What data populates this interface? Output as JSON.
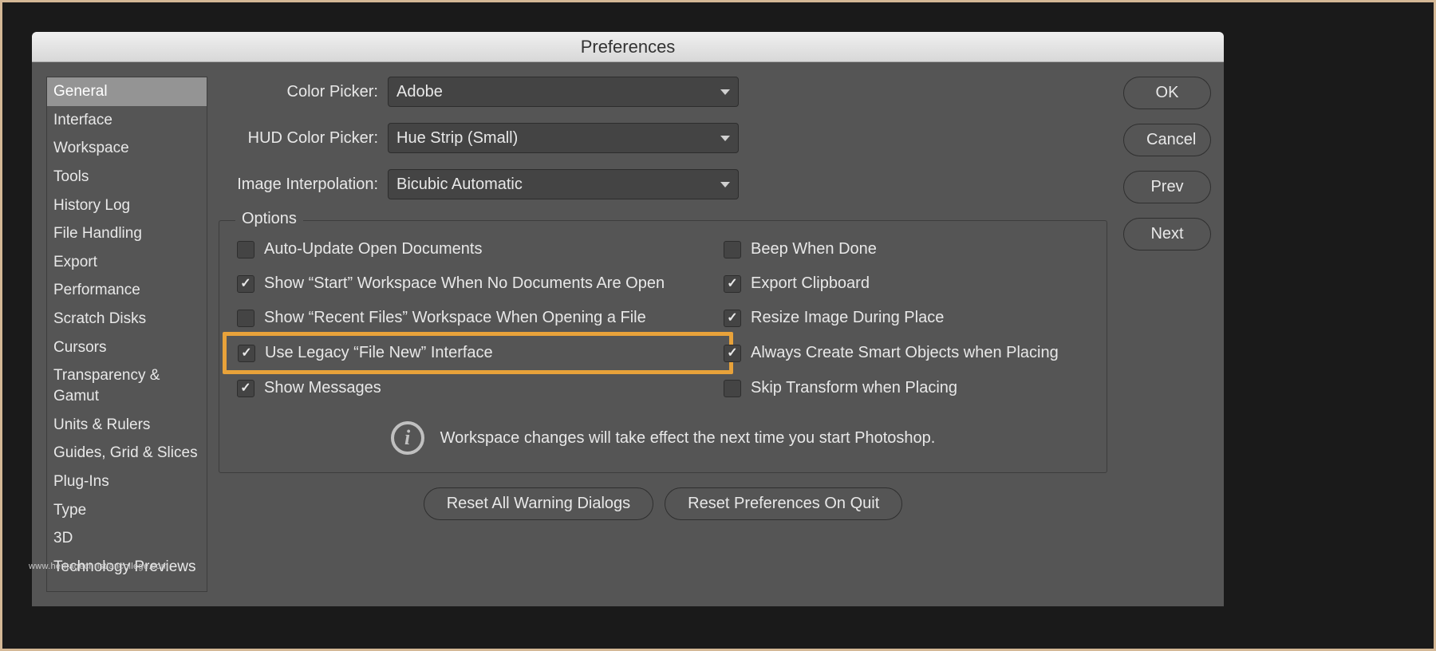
{
  "title": "Preferences",
  "sidebar": {
    "items": [
      "General",
      "Interface",
      "Workspace",
      "Tools",
      "History Log",
      "File Handling",
      "Export",
      "Performance",
      "Scratch Disks",
      "Cursors",
      "Transparency & Gamut",
      "Units & Rulers",
      "Guides, Grid & Slices",
      "Plug-Ins",
      "Type",
      "3D",
      "Technology Previews"
    ],
    "selectedIndex": 0
  },
  "dropdowns": {
    "colorPicker": {
      "label": "Color Picker:",
      "value": "Adobe"
    },
    "hudColorPicker": {
      "label": "HUD Color Picker:",
      "value": "Hue Strip (Small)"
    },
    "imageInterpolation": {
      "label": "Image Interpolation:",
      "value": "Bicubic Automatic"
    }
  },
  "options": {
    "legend": "Options",
    "left": [
      {
        "label": "Auto-Update Open Documents",
        "checked": false
      },
      {
        "label": "Show “Start” Workspace When No Documents Are Open",
        "checked": true
      },
      {
        "label": "Show “Recent Files” Workspace When Opening a File",
        "checked": false
      },
      {
        "label": "Use Legacy “File New” Interface",
        "checked": true,
        "highlighted": true
      },
      {
        "label": "Show Messages",
        "checked": true
      }
    ],
    "right": [
      {
        "label": "Beep When Done",
        "checked": false
      },
      {
        "label": "Export Clipboard",
        "checked": true
      },
      {
        "label": "Resize Image During Place",
        "checked": true
      },
      {
        "label": "Always Create Smart Objects when Placing",
        "checked": true
      },
      {
        "label": "Skip Transform when Placing",
        "checked": false
      }
    ],
    "infoText": "Workspace changes will take effect the next time you start Photoshop."
  },
  "bottomButtons": {
    "resetWarnings": "Reset All Warning Dialogs",
    "resetOnQuit": "Reset Preferences On Quit"
  },
  "sideButtons": {
    "ok": "OK",
    "cancel": "Cancel",
    "prev": "Prev",
    "next": "Next"
  },
  "watermark": "www.heritagechristiancollege.com"
}
